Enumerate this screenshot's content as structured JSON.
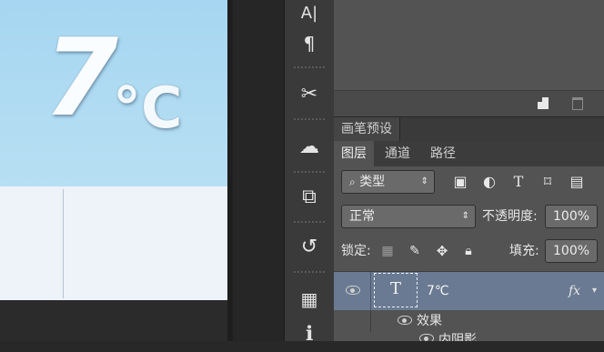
{
  "canvas": {
    "temperature_number": "7",
    "temperature_unit": "°C"
  },
  "tools": [
    {
      "icon": "character-icon",
      "glyph": "A|"
    },
    {
      "icon": "paragraph-icon",
      "glyph": "¶"
    },
    {
      "icon": "tools-icon",
      "glyph": "✂"
    },
    {
      "icon": "creative-cloud-icon",
      "glyph": "☁"
    },
    {
      "icon": "transform-icon",
      "glyph": "⧉"
    },
    {
      "icon": "history-icon",
      "glyph": "↺"
    },
    {
      "icon": "libraries-icon",
      "glyph": "▦"
    },
    {
      "icon": "info-icon",
      "glyph": "ℹ"
    }
  ],
  "brush_presets_tab": "画笔预设",
  "layers_tabs": [
    "图层",
    "通道",
    "路径"
  ],
  "filter": {
    "kind_label": "类型",
    "icons": [
      "image-filter-icon",
      "adjustment-filter-icon",
      "type-filter-icon",
      "shape-filter-icon",
      "smart-object-filter-icon"
    ]
  },
  "blend": {
    "mode": "正常",
    "opacity_label": "不透明度:",
    "opacity_value": "100%"
  },
  "lock": {
    "label": "锁定:",
    "fill_label": "填充:",
    "fill_value": "100%"
  },
  "layer": {
    "thumb_glyph": "T",
    "name": "7℃",
    "fx": "fx"
  },
  "effects": {
    "label": "效果",
    "inner_shadow": "内阴影"
  }
}
